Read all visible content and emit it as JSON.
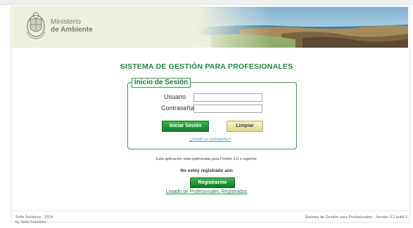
{
  "header": {
    "org_line1": "Ministerio",
    "org_line2": "de Ambiente",
    "seal_icon": "coat-of-arms-icon"
  },
  "main": {
    "title": "SISTEMA DE GESTIÓN PARA PROFESIONALES",
    "login": {
      "legend": "Inicio de Sesión",
      "user_label": "Usuario",
      "user_value": "",
      "pass_label": "Contraseña",
      "pass_value": "",
      "login_button": "Iniciar Sesión",
      "clear_button": "Limpiar",
      "forgot_link": "¿Olvidó su contraseña?"
    },
    "browser_note": "Esta aplicación está optimizada para Firefox 3.0 o superior",
    "not_registered": "No estoy registrado aún",
    "register_button": "Registrarme",
    "list_link": "Listado de Profesionales Registrados"
  },
  "footer": {
    "left_line1": "Sofis Solutions - 2014",
    "left_line2": "by Sofis Solutions",
    "right": "Sistema de Gestión para Profesionales - Versión 9.2 build 2"
  },
  "colors": {
    "brand_green": "#228b3e",
    "header_bg": "#eef0dd"
  }
}
